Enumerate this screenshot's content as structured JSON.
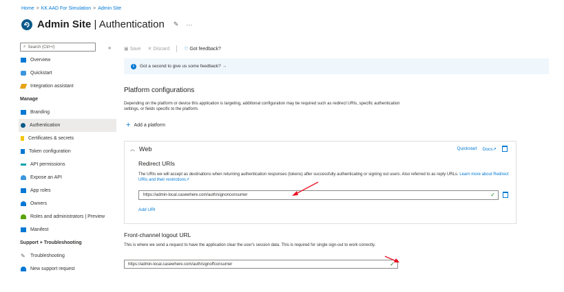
{
  "breadcrumb": [
    "Home",
    "KK AAD For Simulation",
    "Admin Site"
  ],
  "header": {
    "app_name": "Admin Site",
    "divider": " | ",
    "blade": "Authentication"
  },
  "sidebar": {
    "search_placeholder": "Search (Ctrl+/)",
    "collapse": "«",
    "items_top": [
      {
        "label": "Overview",
        "icon": "overview-icon",
        "color": "#0078d4"
      },
      {
        "label": "Quickstart",
        "icon": "quickstart-icon",
        "color": "#0078d4"
      },
      {
        "label": "Integration assistant",
        "icon": "rocket-icon",
        "color": "#e8a317"
      }
    ],
    "manage_header": "Manage",
    "items_manage": [
      {
        "label": "Branding",
        "icon": "branding-icon",
        "color": "#0078d4",
        "active": false
      },
      {
        "label": "Authentication",
        "icon": "authentication-icon",
        "color": "#0b5a8a",
        "active": true
      },
      {
        "label": "Certificates & secrets",
        "icon": "key-icon",
        "color": "#f2c811",
        "active": false
      },
      {
        "label": "Token configuration",
        "icon": "token-icon",
        "color": "#0078d4",
        "active": false
      },
      {
        "label": "API permissions",
        "icon": "api-permissions-icon",
        "color": "#00a2ad",
        "active": false
      },
      {
        "label": "Expose an API",
        "icon": "cloud-icon",
        "color": "#3a96dd",
        "active": false
      },
      {
        "label": "App roles",
        "icon": "app-roles-icon",
        "color": "#0078d4",
        "active": false
      },
      {
        "label": "Owners",
        "icon": "owners-icon",
        "color": "#0078d4",
        "active": false
      },
      {
        "label": "Roles and administrators | Preview",
        "icon": "roles-icon",
        "color": "#57a300",
        "active": false
      },
      {
        "label": "Manifest",
        "icon": "manifest-icon",
        "color": "#0078d4",
        "active": false
      }
    ],
    "support_header": "Support + Troubleshooting",
    "items_support": [
      {
        "label": "Troubleshooting",
        "icon": "wrench-icon",
        "color": "#605e5c"
      },
      {
        "label": "New support request",
        "icon": "support-icon",
        "color": "#0078d4"
      }
    ]
  },
  "toolbar": {
    "save": "Save",
    "discard": "Discard",
    "feedback": "Got feedback?"
  },
  "banner": {
    "text": "Got a second to give us some feedback? →"
  },
  "platform": {
    "title": "Platform configurations",
    "description": "Depending on the platform or device this application is targeting, additional configuration may be required such as redirect URIs, specific authentication settings, or fields specific to the platform.",
    "add_label": "Add a platform"
  },
  "web": {
    "title": "Web",
    "quickstart": "Quickstart",
    "docs": "Docs",
    "redirect_title": "Redirect URIs",
    "redirect_desc": "The URIs we will accept as destinations when returning authentication responses (tokens) after successfully authenticating or signing out users. Also referred to as reply URLs.",
    "redirect_link": "Learn more about Redirect URIs and their restrictions",
    "redirect_value": "https://admin-local.casewhere.com/auth/signonconsumer",
    "add_uri": "Add URI"
  },
  "front_channel": {
    "title": "Front-channel logout URL",
    "description": "This is where we send a request to have the application clear the user's session data. This is required for single sign-out to work correctly.",
    "value": "https://admin-local.casewhere.com/auth/signoffconsumer"
  },
  "colors": {
    "accent": "#0078d4",
    "success": "#107c10",
    "annotation": "#e81123"
  }
}
